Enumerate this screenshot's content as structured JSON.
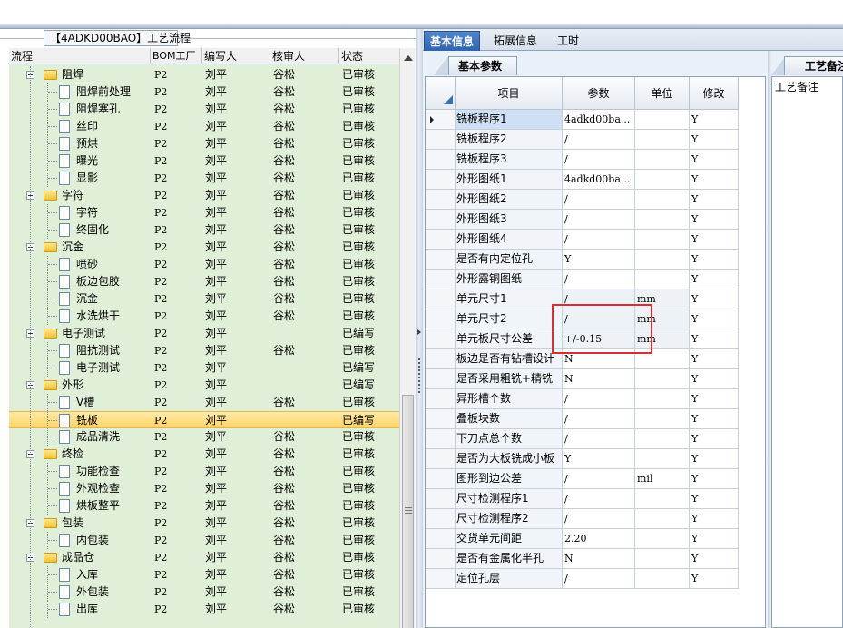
{
  "left_panel": {
    "title": "【4ADKD00BAO】工艺流程",
    "columns": [
      "流程",
      "BOM工厂",
      "编写人",
      "核审人",
      "状态"
    ],
    "rows": [
      {
        "level": 1,
        "kind": "folder",
        "name": "阻焊",
        "bom": "P2",
        "writer": "刘平",
        "reviewer": "谷松",
        "status": "已审核"
      },
      {
        "level": 2,
        "kind": "file",
        "name": "阻焊前处理",
        "bom": "P2",
        "writer": "刘平",
        "reviewer": "谷松",
        "status": "已审核"
      },
      {
        "level": 2,
        "kind": "file",
        "name": "阻焊塞孔",
        "bom": "P2",
        "writer": "刘平",
        "reviewer": "谷松",
        "status": "已审核"
      },
      {
        "level": 2,
        "kind": "file",
        "name": "丝印",
        "bom": "P2",
        "writer": "刘平",
        "reviewer": "谷松",
        "status": "已审核"
      },
      {
        "level": 2,
        "kind": "file",
        "name": "预烘",
        "bom": "P2",
        "writer": "刘平",
        "reviewer": "谷松",
        "status": "已审核"
      },
      {
        "level": 2,
        "kind": "file",
        "name": "曝光",
        "bom": "P2",
        "writer": "刘平",
        "reviewer": "谷松",
        "status": "已审核"
      },
      {
        "level": 2,
        "kind": "file",
        "name": "显影",
        "bom": "P2",
        "writer": "刘平",
        "reviewer": "谷松",
        "status": "已审核"
      },
      {
        "level": 1,
        "kind": "folder",
        "name": "字符",
        "bom": "P2",
        "writer": "刘平",
        "reviewer": "谷松",
        "status": "已审核"
      },
      {
        "level": 2,
        "kind": "file",
        "name": "字符",
        "bom": "P2",
        "writer": "刘平",
        "reviewer": "谷松",
        "status": "已审核"
      },
      {
        "level": 2,
        "kind": "file",
        "name": "终固化",
        "bom": "P2",
        "writer": "刘平",
        "reviewer": "谷松",
        "status": "已审核"
      },
      {
        "level": 1,
        "kind": "folder",
        "name": "沉金",
        "bom": "P2",
        "writer": "刘平",
        "reviewer": "谷松",
        "status": "已审核"
      },
      {
        "level": 2,
        "kind": "file",
        "name": "喷砂",
        "bom": "P2",
        "writer": "刘平",
        "reviewer": "谷松",
        "status": "已审核"
      },
      {
        "level": 2,
        "kind": "file",
        "name": "板边包胶",
        "bom": "P2",
        "writer": "刘平",
        "reviewer": "谷松",
        "status": "已审核"
      },
      {
        "level": 2,
        "kind": "file",
        "name": "沉金",
        "bom": "P2",
        "writer": "刘平",
        "reviewer": "谷松",
        "status": "已审核"
      },
      {
        "level": 2,
        "kind": "file",
        "name": "水洗烘干",
        "bom": "P2",
        "writer": "刘平",
        "reviewer": "谷松",
        "status": "已审核"
      },
      {
        "level": 1,
        "kind": "folder",
        "name": "电子测试",
        "bom": "P2",
        "writer": "刘平",
        "reviewer": "",
        "status": "已编写"
      },
      {
        "level": 2,
        "kind": "file",
        "name": "阻抗测试",
        "bom": "P2",
        "writer": "刘平",
        "reviewer": "谷松",
        "status": "已审核"
      },
      {
        "level": 2,
        "kind": "file",
        "name": "电子测试",
        "bom": "P2",
        "writer": "刘平",
        "reviewer": "",
        "status": "已编写"
      },
      {
        "level": 1,
        "kind": "folder",
        "name": "外形",
        "bom": "P2",
        "writer": "刘平",
        "reviewer": "",
        "status": "已编写"
      },
      {
        "level": 2,
        "kind": "file",
        "name": "V槽",
        "bom": "P2",
        "writer": "刘平",
        "reviewer": "谷松",
        "status": "已审核"
      },
      {
        "level": 2,
        "kind": "file",
        "name": "铣板",
        "bom": "P2",
        "writer": "刘平",
        "reviewer": "",
        "status": "已编写",
        "selected": true
      },
      {
        "level": 2,
        "kind": "file",
        "name": "成品清洗",
        "bom": "P2",
        "writer": "刘平",
        "reviewer": "谷松",
        "status": "已审核"
      },
      {
        "level": 1,
        "kind": "folder",
        "name": "终检",
        "bom": "P2",
        "writer": "刘平",
        "reviewer": "谷松",
        "status": "已审核"
      },
      {
        "level": 2,
        "kind": "file",
        "name": "功能检查",
        "bom": "P2",
        "writer": "刘平",
        "reviewer": "谷松",
        "status": "已审核"
      },
      {
        "level": 2,
        "kind": "file",
        "name": "外观检查",
        "bom": "P2",
        "writer": "刘平",
        "reviewer": "谷松",
        "status": "已审核"
      },
      {
        "level": 2,
        "kind": "file",
        "name": "烘板整平",
        "bom": "P2",
        "writer": "刘平",
        "reviewer": "谷松",
        "status": "已审核"
      },
      {
        "level": 1,
        "kind": "folder",
        "name": "包装",
        "bom": "P2",
        "writer": "刘平",
        "reviewer": "谷松",
        "status": "已审核"
      },
      {
        "level": 2,
        "kind": "file",
        "name": "内包装",
        "bom": "P2",
        "writer": "刘平",
        "reviewer": "谷松",
        "status": "已审核"
      },
      {
        "level": 1,
        "kind": "folder",
        "name": "成品仓",
        "bom": "P2",
        "writer": "刘平",
        "reviewer": "谷松",
        "status": "已审核"
      },
      {
        "level": 2,
        "kind": "file",
        "name": "入库",
        "bom": "P2",
        "writer": "刘平",
        "reviewer": "谷松",
        "status": "已审核"
      },
      {
        "level": 2,
        "kind": "file",
        "name": "外包装",
        "bom": "P2",
        "writer": "刘平",
        "reviewer": "谷松",
        "status": "已审核"
      },
      {
        "level": 2,
        "kind": "file",
        "name": "出库",
        "bom": "P2",
        "writer": "刘平",
        "reviewer": "谷松",
        "status": "已审核"
      }
    ]
  },
  "tabs": [
    "基本信息",
    "拓展信息",
    "工时"
  ],
  "active_tab": 0,
  "sub_tab": "基本参数",
  "param_grid": {
    "columns": [
      "项目",
      "参数",
      "单位",
      "修改"
    ],
    "rows": [
      {
        "item": "铣板程序1",
        "value": "4adkd00ba...",
        "unit": "",
        "mod": "Y",
        "current": true
      },
      {
        "item": "铣板程序2",
        "value": "/",
        "unit": "",
        "mod": "Y"
      },
      {
        "item": "铣板程序3",
        "value": "/",
        "unit": "",
        "mod": "Y"
      },
      {
        "item": "外形图纸1",
        "value": "4adkd00ba...",
        "unit": "",
        "mod": "Y"
      },
      {
        "item": "外形图纸2",
        "value": "/",
        "unit": "",
        "mod": "Y"
      },
      {
        "item": "外形图纸3",
        "value": "/",
        "unit": "",
        "mod": "Y"
      },
      {
        "item": "外形图纸4",
        "value": "/",
        "unit": "",
        "mod": "Y"
      },
      {
        "item": "是否有内定位孔",
        "value": "Y",
        "unit": "",
        "mod": "Y"
      },
      {
        "item": "外形露铜图纸",
        "value": "/",
        "unit": "",
        "mod": "Y"
      },
      {
        "item": "单元尺寸1",
        "value": "/",
        "unit": "mm",
        "mod": "Y",
        "grey": true
      },
      {
        "item": "单元尺寸2",
        "value": "/",
        "unit": "mm",
        "mod": "Y",
        "grey": true
      },
      {
        "item": "单元板尺寸公差",
        "value": "+/-0.15",
        "unit": "mm",
        "mod": "Y",
        "grey": true
      },
      {
        "item": "板边是否有钻槽设计",
        "value": "N",
        "unit": "",
        "mod": "Y"
      },
      {
        "item": "是否采用粗铣+精铣",
        "value": "N",
        "unit": "",
        "mod": "Y"
      },
      {
        "item": "异形槽个数",
        "value": "/",
        "unit": "",
        "mod": "Y"
      },
      {
        "item": "叠板块数",
        "value": "/",
        "unit": "",
        "mod": "Y"
      },
      {
        "item": "下刀点总个数",
        "value": "/",
        "unit": "",
        "mod": "Y"
      },
      {
        "item": "是否为大板铣成小板",
        "value": "Y",
        "unit": "",
        "mod": "Y"
      },
      {
        "item": "图形到边公差",
        "value": "/",
        "unit": "mil",
        "mod": "Y"
      },
      {
        "item": "尺寸检测程序1",
        "value": "/",
        "unit": "",
        "mod": "Y"
      },
      {
        "item": "尺寸检测程序2",
        "value": "/",
        "unit": "",
        "mod": "Y"
      },
      {
        "item": "交货单元间距",
        "value": "2.20",
        "unit": "",
        "mod": "Y"
      },
      {
        "item": "是否有金属化半孔",
        "value": "N",
        "unit": "",
        "mod": "Y"
      },
      {
        "item": "定位孔层",
        "value": "/",
        "unit": "",
        "mod": "Y"
      }
    ]
  },
  "right_strip": {
    "tab": "工艺备注",
    "label": "工艺备注"
  }
}
